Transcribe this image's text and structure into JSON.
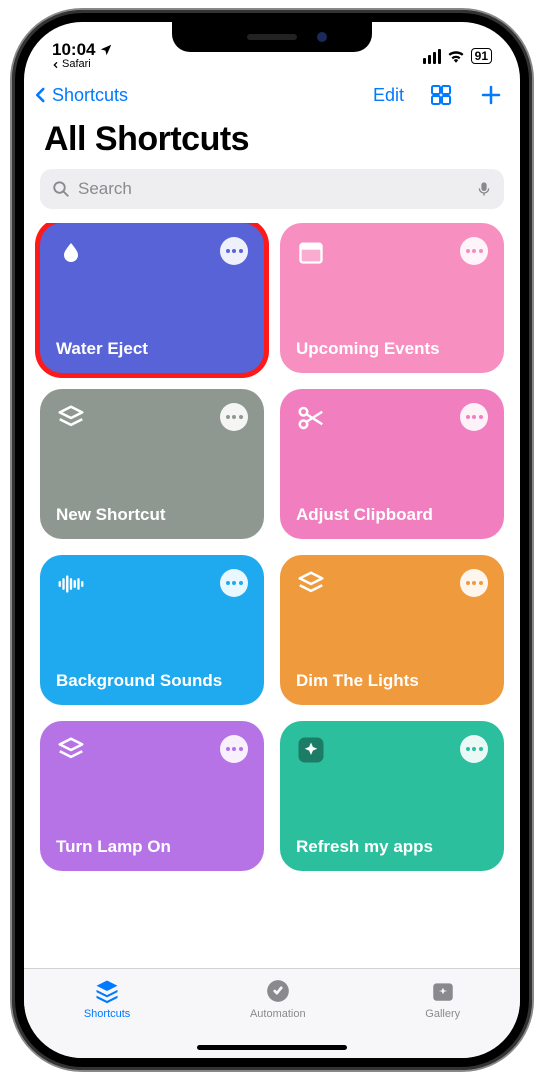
{
  "status": {
    "time": "10:04",
    "back_app": "Safari",
    "battery": "91"
  },
  "nav": {
    "back_label": "Shortcuts",
    "edit_label": "Edit"
  },
  "page": {
    "title": "All Shortcuts"
  },
  "search": {
    "placeholder": "Search"
  },
  "tiles": [
    {
      "label": "Water Eject",
      "color": "#5763d6",
      "icon": "drop",
      "highlight": true,
      "dot_color": "#5763d6"
    },
    {
      "label": "Upcoming Events",
      "color": "#f78fc1",
      "icon": "calendar",
      "highlight": false,
      "dot_color": "#f68dbe"
    },
    {
      "label": "New Shortcut",
      "color": "#8f9890",
      "icon": "stack",
      "highlight": false,
      "dot_color": "#8f9890"
    },
    {
      "label": "Adjust Clipboard",
      "color": "#f17fc0",
      "icon": "scissors",
      "highlight": false,
      "dot_color": "#f17fc0"
    },
    {
      "label": "Background Sounds",
      "color": "#1fa9ee",
      "icon": "soundwave",
      "highlight": false,
      "dot_color": "#1fa9ee"
    },
    {
      "label": "Dim The Lights",
      "color": "#f09a3e",
      "icon": "stack",
      "highlight": false,
      "dot_color": "#f09a3e"
    },
    {
      "label": "Turn Lamp On",
      "color": "#b673e6",
      "icon": "stack",
      "highlight": false,
      "dot_color": "#b673e6"
    },
    {
      "label": "Refresh my apps",
      "color": "#2bbf9d",
      "icon": "sparkle",
      "highlight": false,
      "dot_color": "#2bbf9d"
    }
  ],
  "tabs": {
    "shortcuts": "Shortcuts",
    "automation": "Automation",
    "gallery": "Gallery"
  }
}
